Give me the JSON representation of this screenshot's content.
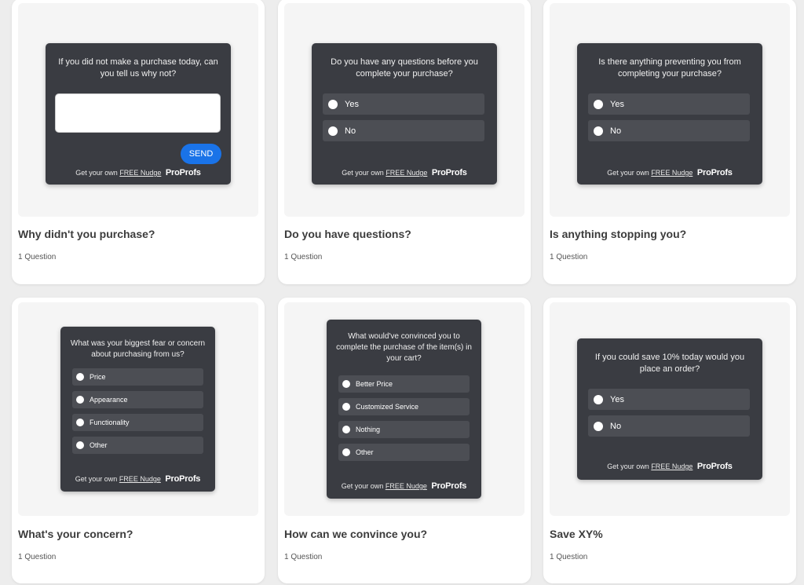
{
  "cards": [
    {
      "title": "Why didn't you purchase?",
      "subtitle": "1 Question",
      "widget": {
        "question": "If you did not make a purchase today, can you tell us why not?",
        "input_placeholder": "",
        "button": "SEND",
        "footer_prefix": "Get your own",
        "footer_link": "FREE Nudge",
        "brand": "ProProfs"
      }
    },
    {
      "title": "Do you have questions?",
      "subtitle": "1 Question",
      "widget": {
        "question": "Do you have any questions before you complete your purchase?",
        "options": [
          "Yes",
          "No"
        ],
        "footer_prefix": "Get your own",
        "footer_link": "FREE Nudge",
        "brand": "ProProfs"
      }
    },
    {
      "title": "Is anything stopping you?",
      "subtitle": "1 Question",
      "widget": {
        "question": "Is there anything preventing you from completing your purchase?",
        "options": [
          "Yes",
          "No"
        ],
        "footer_prefix": "Get your own",
        "footer_link": "FREE Nudge",
        "brand": "ProProfs"
      }
    },
    {
      "title": "What's your concern?",
      "subtitle": "1 Question",
      "widget": {
        "question": "What was your biggest fear or concern about purchasing from us?",
        "options": [
          "Price",
          "Appearance",
          "Functionality",
          "Other"
        ],
        "footer_prefix": "Get your own",
        "footer_link": "FREE Nudge",
        "brand": "ProProfs"
      }
    },
    {
      "title": "How can we convince you?",
      "subtitle": "1 Question",
      "widget": {
        "question": "What would've convinced you to complete the purchase of the item(s) in your cart?",
        "options": [
          "Better Price",
          "Customized Service",
          "Nothing",
          "Other"
        ],
        "footer_prefix": "Get your own",
        "footer_link": "FREE Nudge",
        "brand": "ProProfs"
      }
    },
    {
      "title": "Save XY%",
      "subtitle": "1 Question",
      "widget": {
        "question": "If you could save 10% today would you place an order?",
        "options": [
          "Yes",
          "No"
        ],
        "footer_prefix": "Get your own",
        "footer_link": "FREE Nudge",
        "brand": "ProProfs"
      }
    }
  ]
}
